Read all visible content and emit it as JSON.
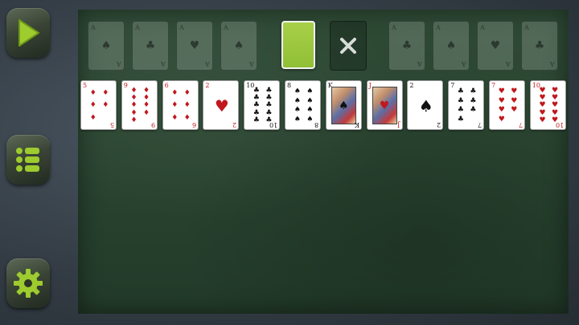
{
  "sidebar": {
    "buttons": [
      {
        "id": "play",
        "icon": "play-icon"
      },
      {
        "id": "menu",
        "icon": "menu-list-icon"
      },
      {
        "id": "settings",
        "icon": "gear-icon"
      }
    ],
    "accent_color": "#9ecb2e"
  },
  "table": {
    "felt_color": "#2b4632",
    "foundations": [
      {
        "rank": "A",
        "suit": "♠"
      },
      {
        "rank": "A",
        "suit": "♣"
      },
      {
        "rank": "A",
        "suit": "♥"
      },
      {
        "rank": "A",
        "suit": "♠"
      },
      {
        "rank": "A",
        "suit": "♣"
      },
      {
        "rank": "A",
        "suit": "♠"
      },
      {
        "rank": "A",
        "suit": "♥"
      },
      {
        "rank": "A",
        "suit": "♣"
      }
    ],
    "stock": {
      "back_color": "#9ccb3f"
    },
    "waste": {
      "icon": "close-x-icon"
    },
    "tableau": [
      {
        "rank": "5",
        "suit": "♦",
        "color": "red",
        "pips": 5
      },
      {
        "rank": "9",
        "suit": "♦",
        "color": "red",
        "pips": 9
      },
      {
        "rank": "6",
        "suit": "♦",
        "color": "red",
        "pips": 6
      },
      {
        "rank": "2",
        "suit": "♥",
        "color": "red",
        "pips": 2
      },
      {
        "rank": "10",
        "suit": "♣",
        "color": "black",
        "pips": 10
      },
      {
        "rank": "8",
        "suit": "♠",
        "color": "black",
        "pips": 8
      },
      {
        "rank": "K",
        "suit": "♠",
        "color": "black",
        "pips": 0
      },
      {
        "rank": "J",
        "suit": "♥",
        "color": "red",
        "pips": 0
      },
      {
        "rank": "2",
        "suit": "♠",
        "color": "black",
        "pips": 2
      },
      {
        "rank": "7",
        "suit": "♣",
        "color": "black",
        "pips": 7
      },
      {
        "rank": "7",
        "suit": "♥",
        "color": "red",
        "pips": 7
      },
      {
        "rank": "10",
        "suit": "♥",
        "color": "red",
        "pips": 10
      }
    ]
  }
}
